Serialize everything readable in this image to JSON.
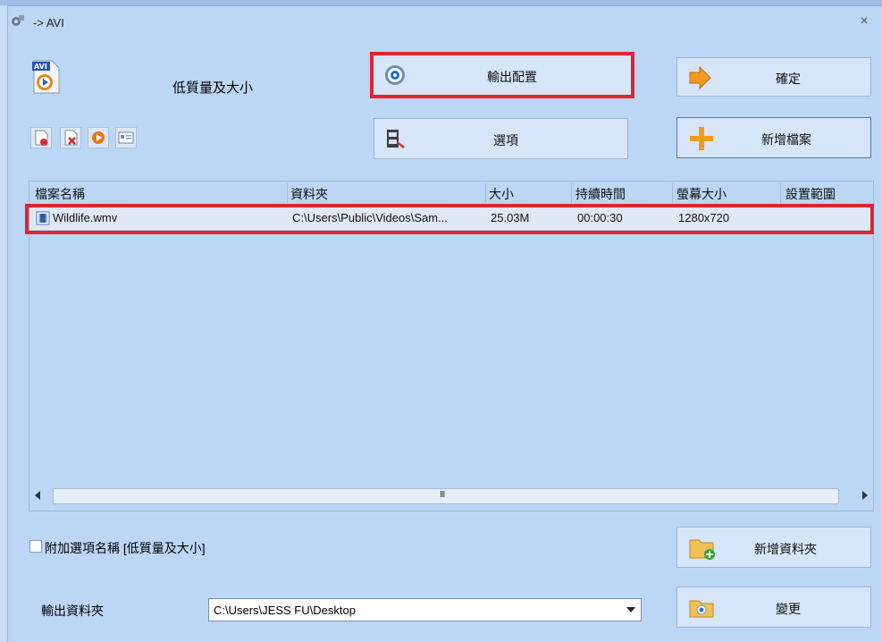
{
  "window": {
    "title": "-> AVI",
    "close_glyph": "×"
  },
  "profile": {
    "name": "低質量及大小",
    "icon": "avi-file-icon"
  },
  "buttons": {
    "output_config": "輸出配置",
    "ok": "確定",
    "options": "選項",
    "add_file": "新增檔案",
    "add_folder": "新增資料夾",
    "change": "變更"
  },
  "toolbar": [
    {
      "name": "remove-file-icon"
    },
    {
      "name": "delete-icon"
    },
    {
      "name": "play-icon"
    },
    {
      "name": "media-info-icon"
    }
  ],
  "list": {
    "columns": [
      "檔案名稱",
      "資料夾",
      "大小",
      "持續時間",
      "螢幕大小",
      "設置範圍"
    ],
    "rows": [
      {
        "filename": "Wildlife.wmv",
        "folder": "C:\\Users\\Public\\Videos\\Sam...",
        "size": "25.03M",
        "duration": "00:00:30",
        "resolution": "1280x720",
        "range": ""
      }
    ],
    "scroll_grip": "III"
  },
  "append_option": {
    "label": "附加選項名稱 [低質量及大小]",
    "checked": false
  },
  "output_folder": {
    "label": "輸出資料夾",
    "value": "C:\\Users\\JESS FU\\Desktop"
  },
  "highlight_color": "#e0232f"
}
